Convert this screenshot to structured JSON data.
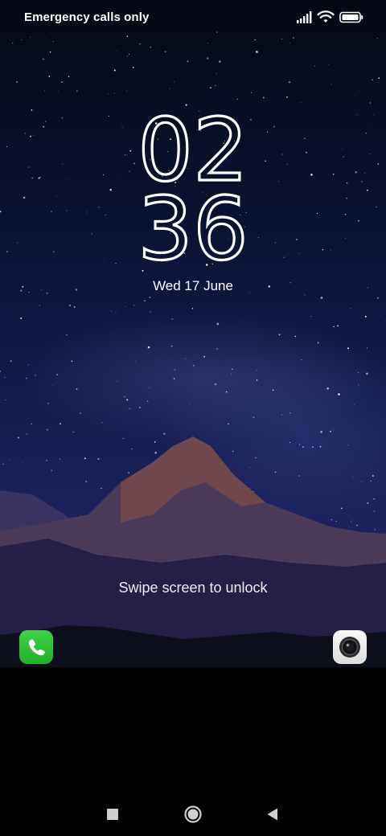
{
  "status_bar": {
    "carrier": "Emergency calls only",
    "icons": [
      "signal-icon",
      "wifi-icon",
      "battery-icon"
    ]
  },
  "lockscreen": {
    "hour": "02",
    "minute": "36",
    "date": "Wed 17 June",
    "hint": "Swipe screen to unlock"
  },
  "shortcuts": {
    "left": "phone-icon",
    "right": "camera-icon",
    "phone_color": "#2bbf33",
    "camera_color": "#eeeeee"
  },
  "navigation": {
    "buttons": [
      "recents-icon",
      "home-icon",
      "back-icon"
    ]
  }
}
